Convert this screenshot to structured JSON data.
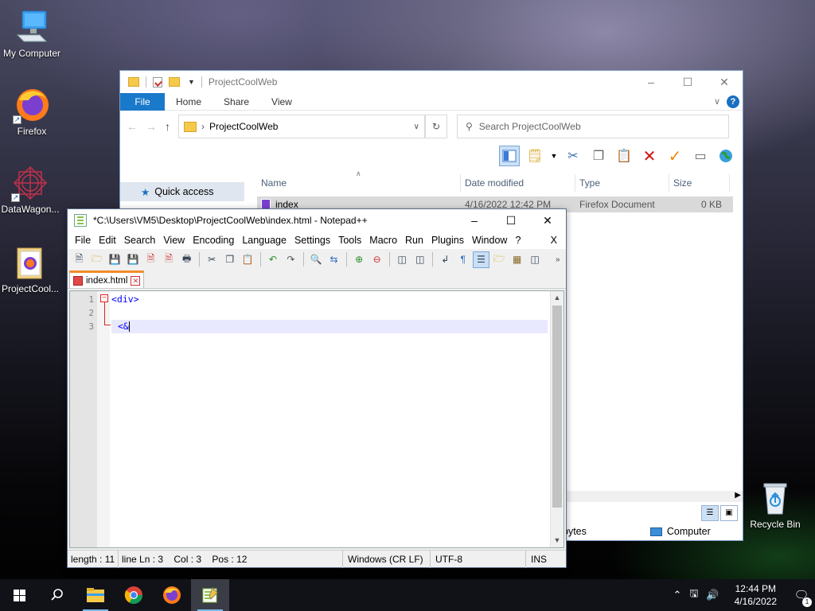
{
  "desktop": {
    "icons": [
      {
        "label": "My Computer"
      },
      {
        "label": "Firefox"
      },
      {
        "label": "DataWagon..."
      },
      {
        "label": "ProjectCool..."
      },
      {
        "label": "Recycle Bin"
      }
    ]
  },
  "explorer": {
    "title": "ProjectCoolWeb",
    "ribbon_tabs": [
      "File",
      "Home",
      "Share",
      "View"
    ],
    "address": "ProjectCoolWeb",
    "search_placeholder": "Search ProjectCoolWeb",
    "nav": {
      "quick_access": "Quick access"
    },
    "columns": [
      "Name",
      "Date modified",
      "Type",
      "Size"
    ],
    "files": [
      {
        "name": "index",
        "date": "4/16/2022 12:42 PM",
        "type": "Firefox Document",
        "size": "0 KB"
      }
    ],
    "status": {
      "bytes": "bytes",
      "computer": "Computer"
    }
  },
  "notepad": {
    "title": "*C:\\Users\\VM5\\Desktop\\ProjectCoolWeb\\index.html - Notepad++",
    "menu": [
      "File",
      "Edit",
      "Search",
      "View",
      "Encoding",
      "Language",
      "Settings",
      "Tools",
      "Macro",
      "Run",
      "Plugins",
      "Window",
      "?"
    ],
    "menu_close": "X",
    "tab_name": "index.html",
    "lines": [
      {
        "no": "1",
        "text": "<div>"
      },
      {
        "no": "2",
        "text": ""
      },
      {
        "no": "3",
        "text": "<&"
      }
    ],
    "status": {
      "length": "length : 11",
      "position": "line Ln : 3    Col : 3    Pos : 12",
      "eol": "Windows (CR LF)",
      "encoding": "UTF-8",
      "mode": "INS"
    }
  },
  "taskbar": {
    "time": "12:44 PM",
    "date": "4/16/2022",
    "notification_count": "1"
  },
  "colors": {
    "accent": "#1979ca",
    "tab_highlight": "#f28c28",
    "code_tag": "#0000ff"
  }
}
